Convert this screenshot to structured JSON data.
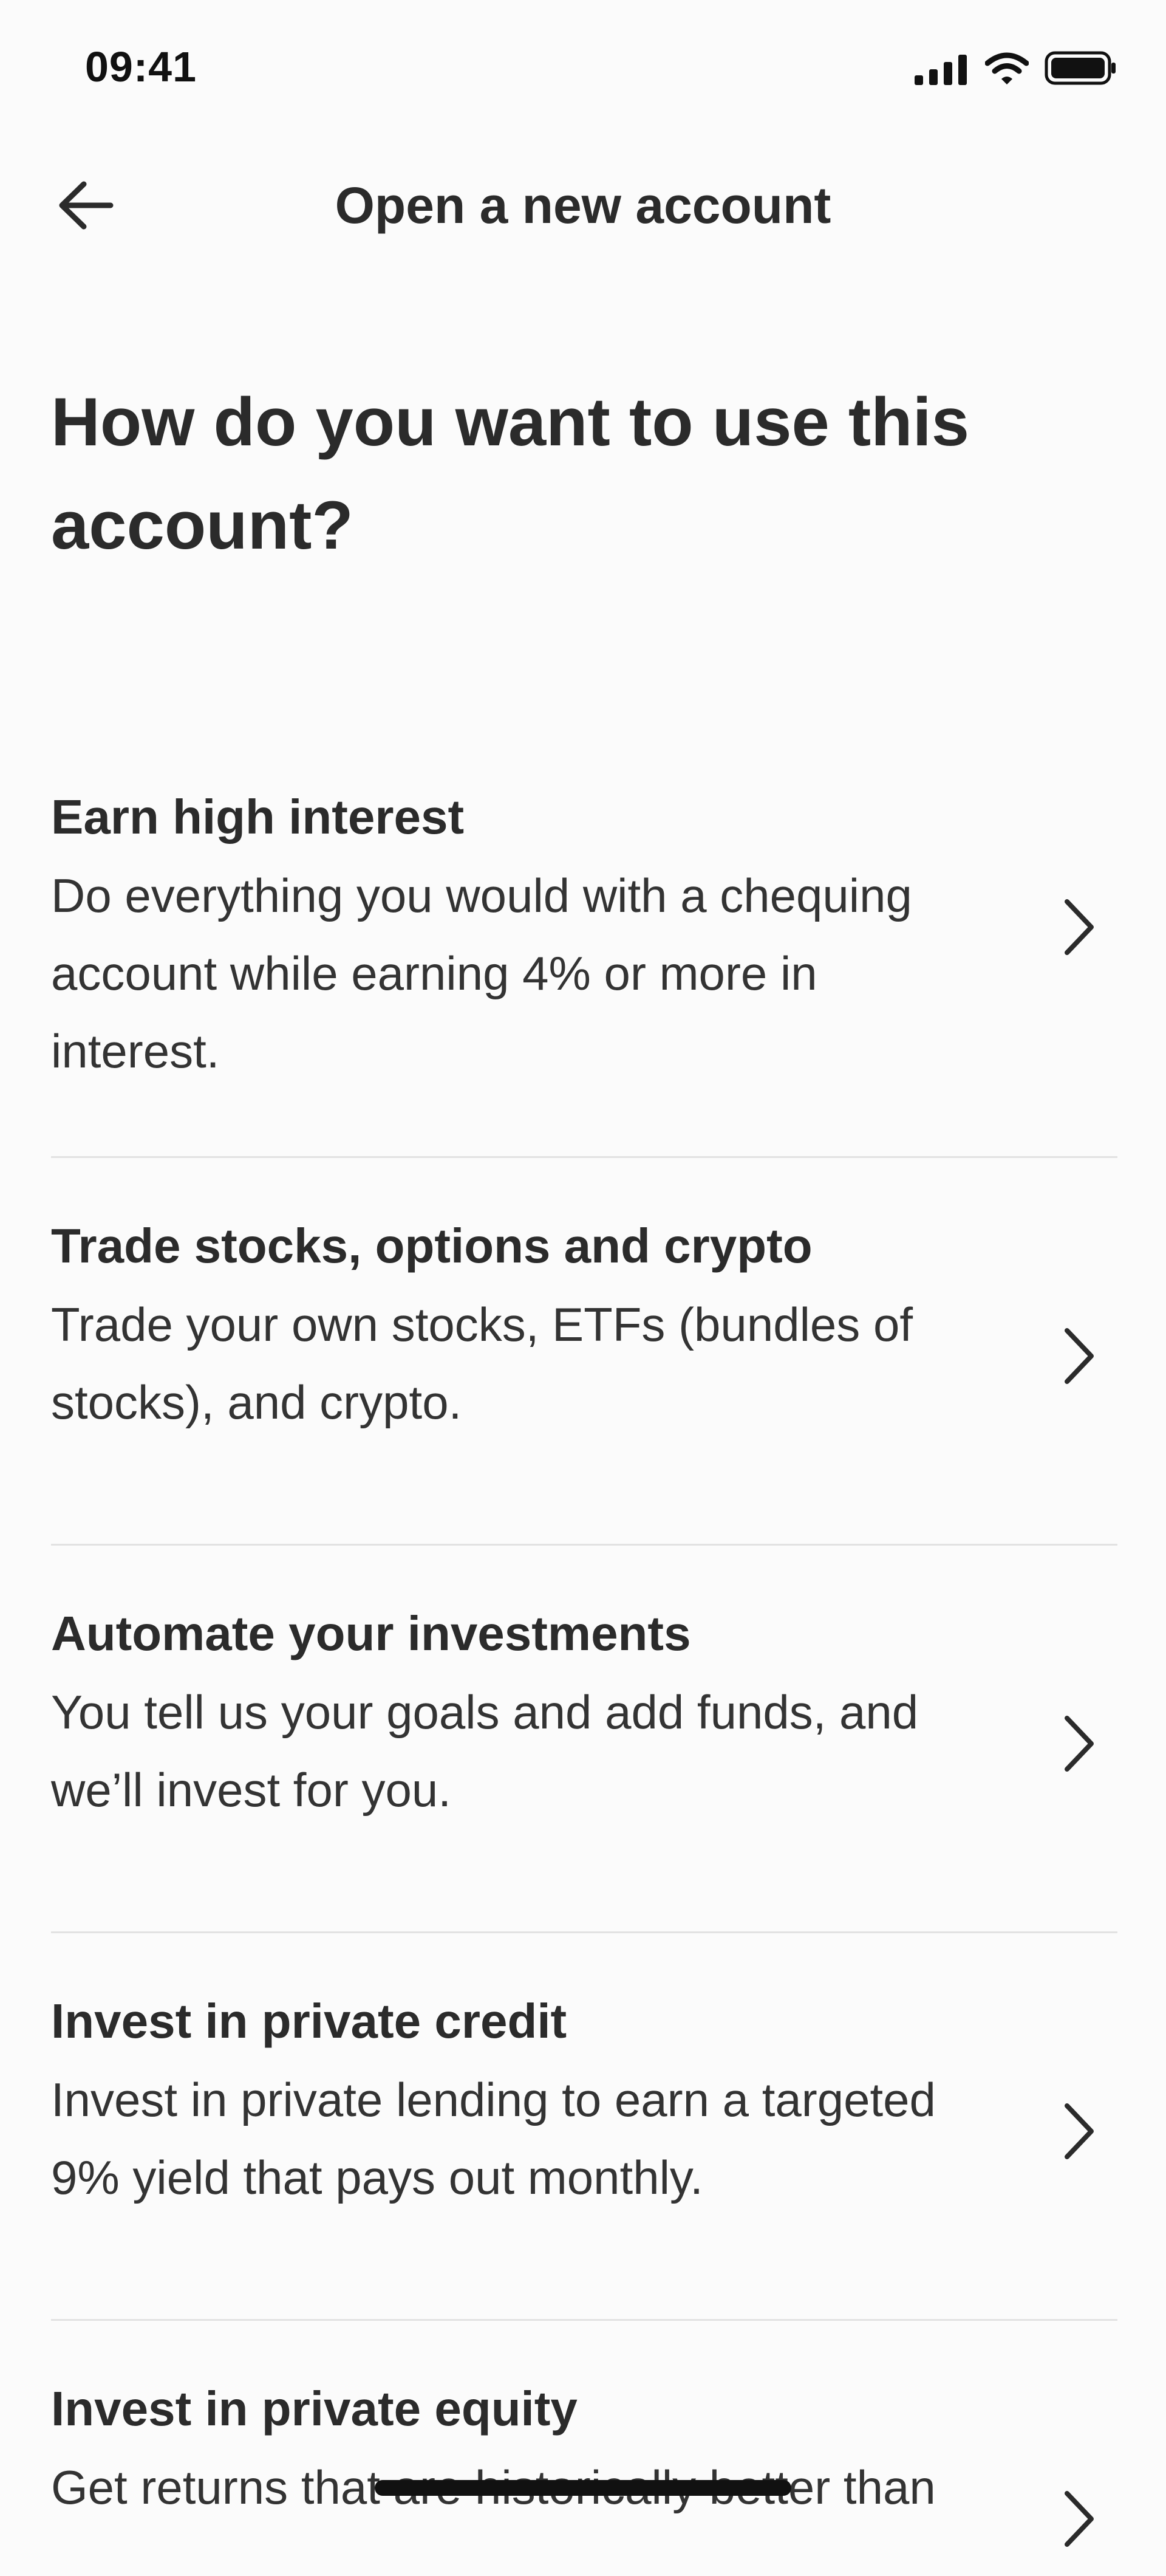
{
  "status_bar": {
    "time": "09:41",
    "icons": [
      "cellular-signal-icon",
      "wifi-icon",
      "battery-icon"
    ]
  },
  "header": {
    "back_icon": "arrow-left-icon",
    "title": "Open a new account"
  },
  "page": {
    "title": "How do you want to use this account?"
  },
  "options": [
    {
      "title": "Earn high interest",
      "description": "Do everything you would with a chequing account while earning 4% or more in interest."
    },
    {
      "title": "Trade stocks, options and crypto",
      "description": "Trade your own stocks, ETFs (bundles of stocks), and crypto."
    },
    {
      "title": "Automate your investments",
      "description": "You tell us your goals and add funds, and we’ll invest for you."
    },
    {
      "title": "Invest in private credit",
      "description": "Invest in private lending to earn a targeted 9% yield that pays out monthly."
    },
    {
      "title": "Invest in private equity",
      "description": "Get returns that are historically better than"
    }
  ],
  "colors": {
    "background": "#fbfbfb",
    "text": "#2b2b2b",
    "divider": "#e2e2e2"
  }
}
